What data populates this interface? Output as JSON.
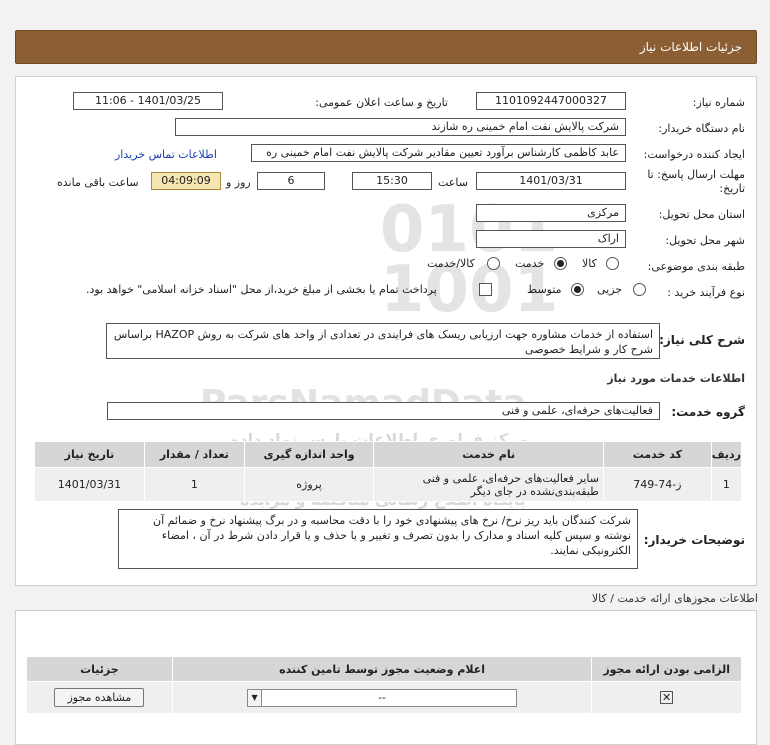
{
  "page": {
    "title": "جزئیات اطلاعات نیاز"
  },
  "form": {
    "need_number": {
      "label": "شماره نیاز:",
      "value": "1101092447000327"
    },
    "announce_date": {
      "label": "تاریخ و ساعت اعلان عمومی:",
      "value": "1401/03/25 - 11:06"
    },
    "buyer_org": {
      "label": "نام دستگاه خریدار:",
      "value": "شرکت پالایش نفت امام خمینی  ره  شازند"
    },
    "requester": {
      "label": "ایجاد کننده درخواست:",
      "value": "عابد کاظمی کارشناس برآورد تعیین مقادیر شرکت پالایش نفت امام خمینی  ره",
      "contact_link": "اطلاعات تماس خریدار"
    },
    "deadline": {
      "label_line1": "مهلت ارسال پاسخ: تا",
      "label_line2": "تاریخ:",
      "date": "1401/03/31",
      "time_label": "ساعت",
      "time": "15:30",
      "days": "6",
      "days_label": "روز و",
      "remaining": "04:09:09",
      "remaining_label": "ساعت باقی مانده"
    },
    "province": {
      "label": "استان محل تحویل:",
      "value": "مرکزی"
    },
    "city": {
      "label": "شهر محل تحویل:",
      "value": "اراک"
    },
    "category": {
      "label": "طبقه بندی موضوعی:",
      "options": [
        "کالا",
        "خدمت",
        "کالا/خدمت"
      ],
      "selected": "خدمت"
    },
    "purchase_type": {
      "label": "نوع فرآیند خرید :",
      "options": [
        "جزیی",
        "متوسط"
      ],
      "selected": "متوسط",
      "treasury_note": "پرداخت تمام یا بخشی از مبلغ خرید،از محل \"اسناد خزانه اسلامی\" خواهد بود."
    }
  },
  "description": {
    "label": "شرح کلی نیاز:",
    "text": "استفاده از خدمات مشاوره جهت ارزیابی ریسک های فرایندی در تعدادی از واحد های شرکت به روش HAZOP براساس شرح کار و شرایط خصوصی"
  },
  "services": {
    "section_title": "اطلاعات خدمات مورد نیاز",
    "group_label": "گروه خدمت:",
    "group_value": "فعالیت‌های حرفه‌ای، علمی و فنی",
    "columns": [
      "ردیف",
      "کد خدمت",
      "نام خدمت",
      "واحد اندازه گیری",
      "تعداد / مقدار",
      "تاریخ نیاز"
    ],
    "rows": [
      [
        "1",
        "ز-74-749",
        "سایر فعالیت‌های حرفه‌ای، علمی و فنی طبقه‌بندی‌نشده در جای دیگر",
        "پروژه",
        "1",
        "1401/03/31"
      ]
    ]
  },
  "buyer_notes": {
    "label": "توضیحات خریدار:",
    "text": "شرکت کنندگان باید ریز نرخ/ نرخ های پیشنهادی خود را با دقت محاسبه و در برگ پیشنهاد نرخ و ضمائم آن نوشته و سپس کلیه اسناد و مدارک را بدون تصرف و تغییر و یا حذف و یا قرار دادن شرط در آن ، امضاء الکترونیکی نمایند."
  },
  "permits": {
    "section_title": "اطلاعات مجوزهای ارائه خدمت / کالا",
    "columns": [
      "الزامی بودن ارائه مجوز",
      "اعلام وضعیت مجوز توسط تامین کننده",
      "جزئیات"
    ],
    "select_value": "--",
    "view_button": "مشاهده مجوز"
  },
  "watermark": {
    "text1": "ParsNamadData",
    "text2": "مرکز فراوری اطلاعات پارس نماد داده",
    "text3": "پایگاه اطلاع رسانی مناقصه و مزایده"
  },
  "colors": {
    "header": "#8b5e34",
    "highlight": "#f5e5b0",
    "link": "#1a3fb0"
  }
}
